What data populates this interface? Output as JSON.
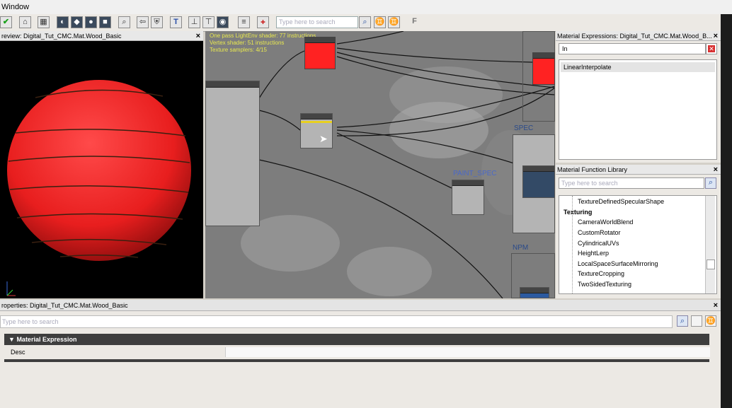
{
  "window": {
    "title": "Window"
  },
  "toolbar": {
    "search_placeholder": "Type here to search"
  },
  "preview": {
    "title": "review: Digital_Tut_CMC.Mat.Wood_Basic",
    "close": "×"
  },
  "graph": {
    "stats": [
      "One pass LightEnv shader: 77 instructions",
      "Vertex shader: 51 instructions",
      "Texture samplers: 4/15"
    ],
    "labels": {
      "spec": "SPEC",
      "paint_spec": "PAINT_SPEC",
      "npm": "NPM"
    }
  },
  "expressions": {
    "title": "Material Expressions: Digital_Tut_CMC.Mat.Wood_B...",
    "search_value": "In",
    "results": [
      "LinearInterpolate"
    ],
    "close": "×"
  },
  "library": {
    "title": "Material Function Library",
    "search_placeholder": "Type here to search",
    "items": [
      "TextureDefinedSpecularShape",
      "Texturing",
      "CameraWorldBlend",
      "CustomRotator",
      "CylindricalUVs",
      "HeightLerp",
      "LocalSpaceSurfaceMirroring",
      "TextureCropping",
      "TwoSidedTexturing"
    ],
    "close": "×"
  },
  "properties": {
    "title": "roperties: Digital_Tut_CMC.Mat.Wood_Basic",
    "search_placeholder": "Type here to search",
    "section": "Material Expression",
    "field": "Desc",
    "close": "×"
  },
  "colors": {
    "node_red": "#ff2a2a",
    "sphere_red": "#e82020",
    "graph_bg": "#7d7d7d",
    "stats_text": "#e8e850",
    "label_blue": "#2a4a8a"
  }
}
